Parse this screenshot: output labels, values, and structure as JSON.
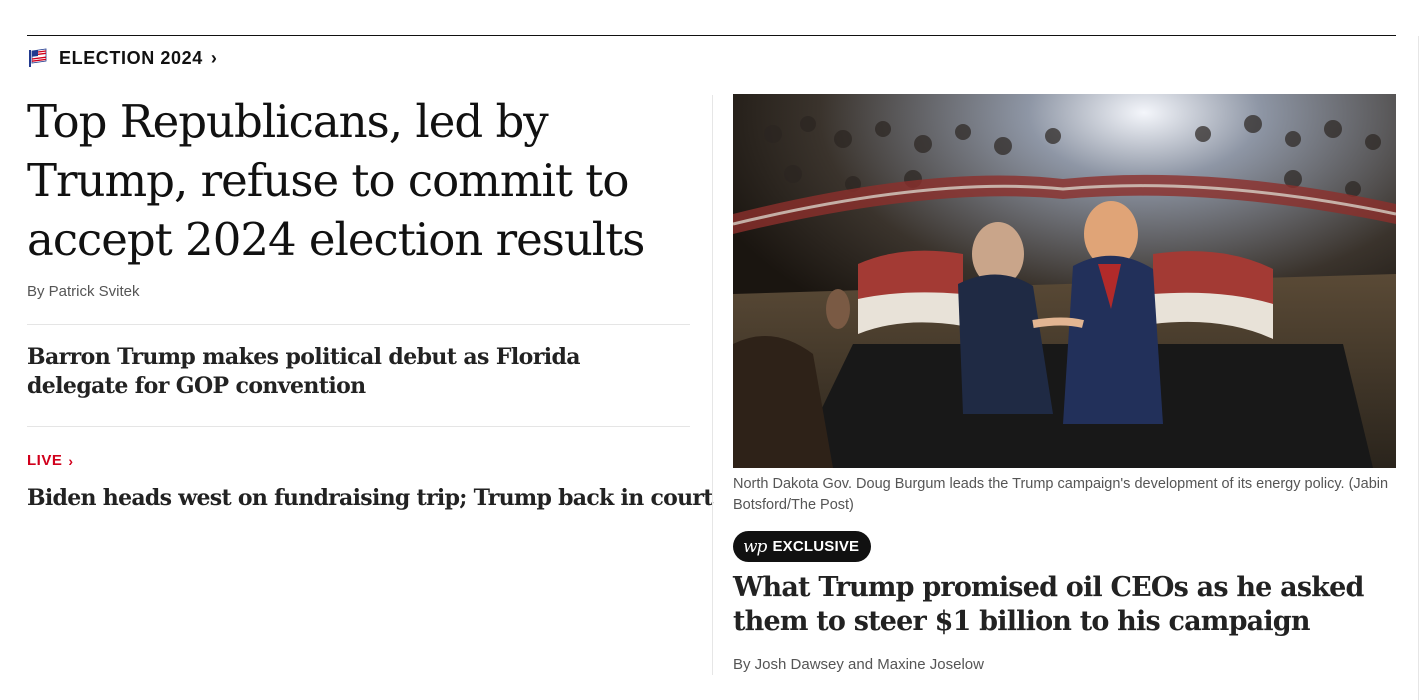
{
  "section": {
    "label": "ELECTION 2024",
    "chevron": "›",
    "icon": "flag-icon"
  },
  "lead_story": {
    "headline": "Top Republicans, led by Trump, refuse to commit to accept 2024 election results",
    "byline": "By Patrick Svitek"
  },
  "second_story": {
    "headline": "Barron Trump makes political debut as Florida delegate for GOP convention"
  },
  "live_story": {
    "label": "LIVE",
    "chevron": "›",
    "headline": "Biden heads west on fundraising trip; Trump back in court"
  },
  "feature": {
    "image_alt": "Two men shaking hands on a stage at a rally",
    "caption": "North Dakota Gov. Doug Burgum leads the Trump campaign's development of its energy policy. (Jabin Botsford/The Post)",
    "badge_logo": "wp",
    "badge_label": "EXCLUSIVE",
    "headline": "What Trump promised oil CEOs as he asked them to steer $1 billion to his campaign",
    "byline": "By Josh Dawsey and Maxine Joselow"
  },
  "colors": {
    "live_red": "#d1001c",
    "text": "#111111",
    "meta": "#555555",
    "rule": "#e5e5e5"
  }
}
